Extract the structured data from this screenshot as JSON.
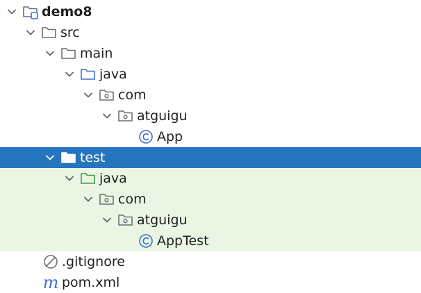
{
  "project_tree": {
    "root": {
      "label": "demo8"
    },
    "src": {
      "label": "src"
    },
    "main": {
      "label": "main"
    },
    "main_java": {
      "label": "java"
    },
    "main_com": {
      "label": "com"
    },
    "main_atguigu": {
      "label": "atguigu"
    },
    "app_class": {
      "label": "App"
    },
    "test": {
      "label": "test"
    },
    "test_java": {
      "label": "java"
    },
    "test_com": {
      "label": "com"
    },
    "test_atguigu": {
      "label": "atguigu"
    },
    "apptest_class": {
      "label": "AppTest"
    },
    "gitignore": {
      "label": ".gitignore"
    },
    "pom": {
      "label": "pom.xml",
      "icon_glyph": "m"
    }
  },
  "colors": {
    "selection": "#2675bf",
    "test_background": "#eaf6e3",
    "source_folder": "#3b6fd6",
    "test_folder": "#3e9b3e",
    "class_icon": "#3b6fd6"
  }
}
